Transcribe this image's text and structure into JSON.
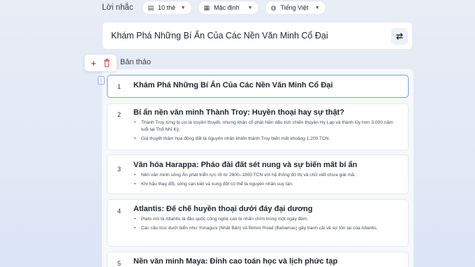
{
  "topbar": {
    "label": "Lời nhắc",
    "cards_select": "10 thẻ",
    "style_select": "Mặc định",
    "language_select": "Tiếng Việt"
  },
  "prompt": {
    "text": "Khám Phá Những Bí Ẩn Của Các Nền Văn Minh Cổ Đại"
  },
  "outline": {
    "title": "Bản thảo",
    "cards": [
      {
        "number": "1",
        "heading": "Khám Phá Những Bí Ẩn Của Các Nền Văn Minh Cổ Đại",
        "bullets": []
      },
      {
        "number": "2",
        "heading": "Bí ẩn nền văn minh Thành Troy: Huyền thoại hay sự thật?",
        "bullets": [
          "Thành Troy từng bị coi là truyền thuyết, nhưng khảo cổ phát hiện dấu tích chiến thuyền Hy Lạp và thành lũy hơn 3.000 năm tuổi tại Thổ Nhĩ Kỳ.",
          "Giả thuyết thảm họa động đất là nguyên nhân khiến thành Troy biến mất khoảng 1.200 TCN."
        ]
      },
      {
        "number": "3",
        "heading": "Văn hóa Harappa: Pháo đài đất sét nung và sự biến mất bí ẩn",
        "bullets": [
          "Nền văn minh sông Ấn phát triển rực rỡ từ 2800–1800 TCN với hệ thống đô thị và chữ viết chưa giải mã.",
          "Khí hậu thay đổi, sông cạn kiệt và xung đột có thể là nguyên nhân suy tàn."
        ]
      },
      {
        "number": "4",
        "heading": "Atlantis: Đế chế huyền thoại dưới đáy đại dương",
        "bullets": [
          "Plato mô tả Atlantis là đảo quốc công nghệ cao bị nhấn chìm trong một ngày đêm.",
          "Các cấu trúc dưới biển như Yonaguni (Nhật Bản) và Bimini Road (Bahamas) gây tranh cãi về sự tồn tại của Atlantis."
        ]
      },
      {
        "number": "5",
        "heading": "Nền văn minh Maya: Đỉnh cao toán học và lịch phức tạp",
        "bullets": []
      }
    ]
  },
  "icons": {
    "cards_select": "card-stack-icon",
    "style_select": "layout-icon",
    "language_select": "globe-icon",
    "prompt_action": "swap-icon",
    "add": "plus-icon",
    "delete": "trash-icon",
    "drag": "drag-handle-icon"
  },
  "colors": {
    "delete_icon": "#e24b5a",
    "active_card_border": "#7a9de0"
  }
}
